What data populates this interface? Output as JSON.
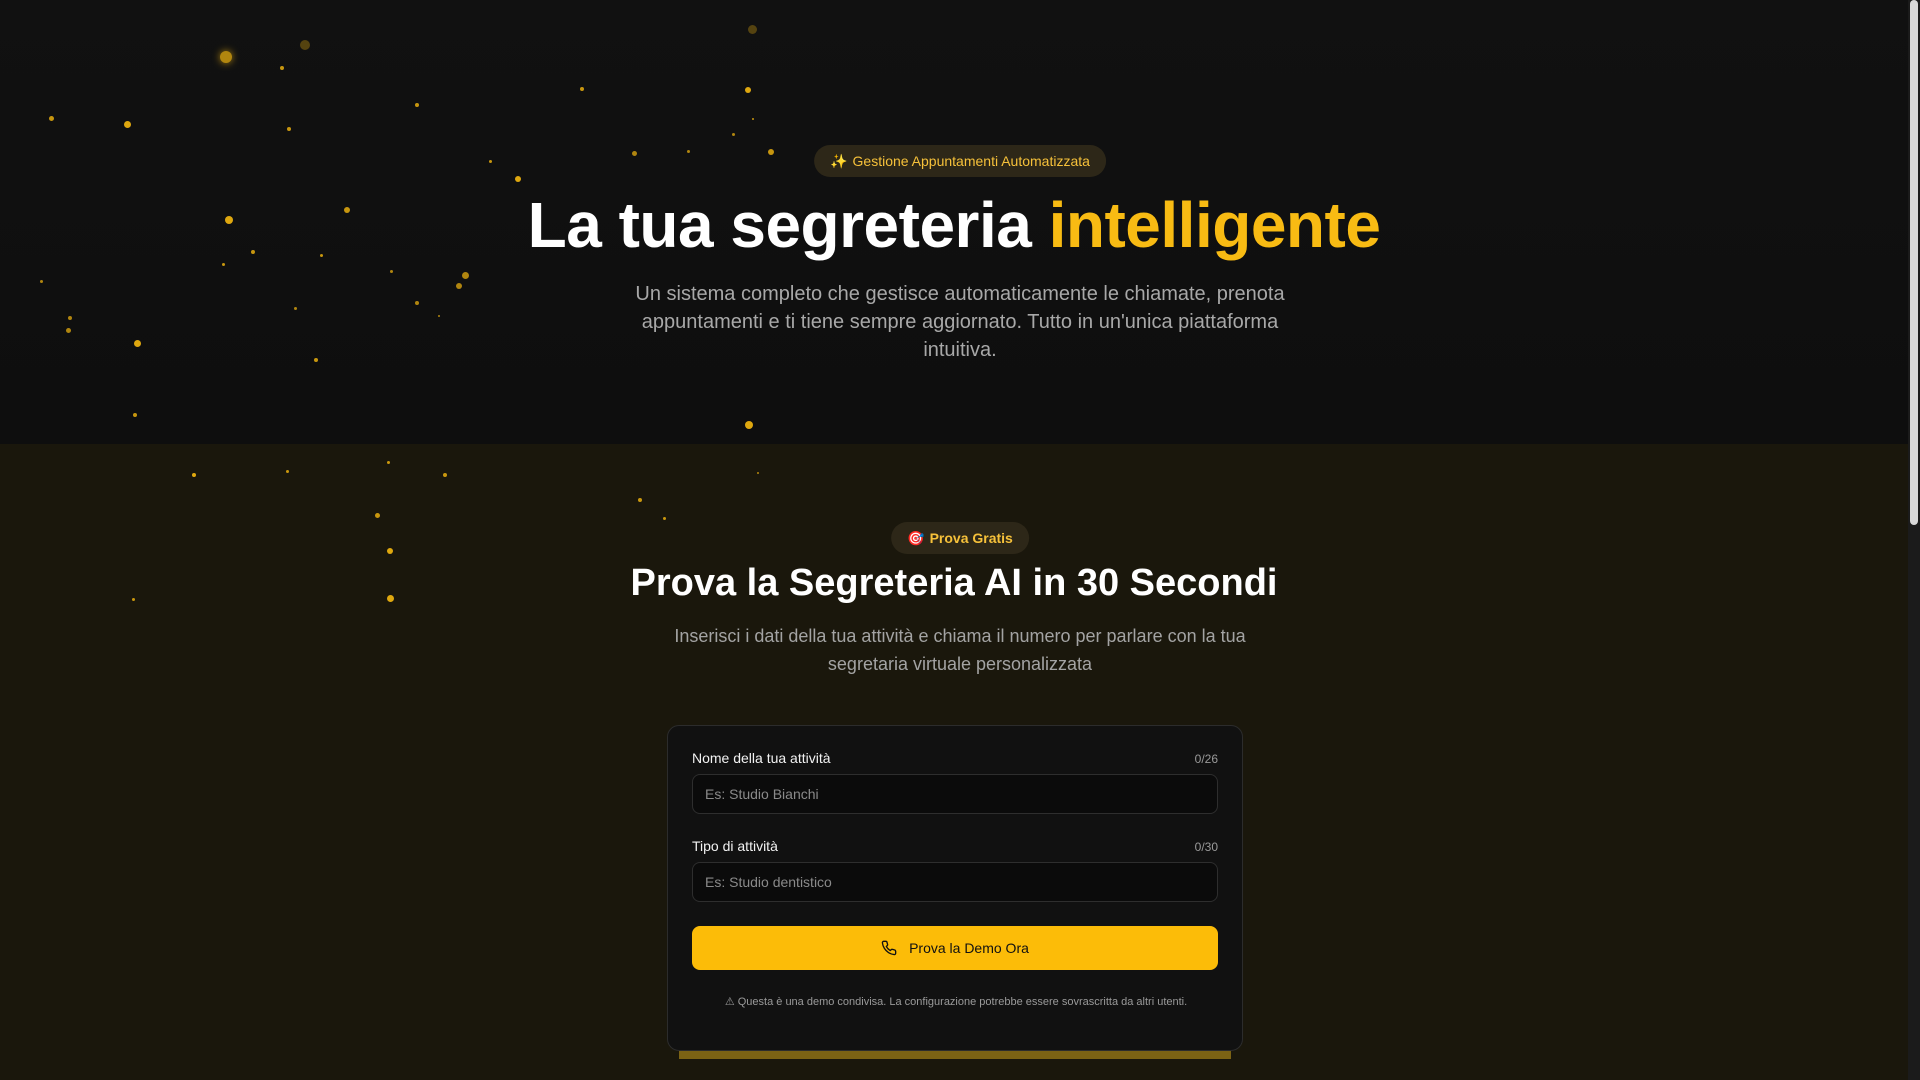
{
  "hero": {
    "badge_emoji": "✨",
    "badge_text": "Gestione Appuntamenti Automatizzata",
    "title_main": "La tua segreteria ",
    "title_accent": "intelligente",
    "subtitle": "Un sistema completo che gestisce automaticamente le chiamate, prenota appuntamenti e ti tiene sempre aggiornato. Tutto in un'unica piattaforma intuitiva."
  },
  "demo": {
    "badge_emoji": "🎯",
    "badge_text": "Prova Gratis",
    "title": "Prova la Segreteria AI in 30 Secondi",
    "subtitle": "Inserisci i dati della tua attività e chiama il numero per parlare con la tua segretaria virtuale personalizzata",
    "form": {
      "business_name_label": "Nome della tua attività",
      "business_name_count": "0/26",
      "business_name_placeholder": "Es: Studio Bianchi",
      "business_name_value": "",
      "business_type_label": "Tipo di attività",
      "business_type_count": "0/30",
      "business_type_placeholder": "Es: Studio dentistico",
      "business_type_value": "",
      "submit_label": "Prova la Demo Ora",
      "warning_icon": "warning-icon",
      "warning_text": "⚠ Questa è una demo condivisa. La configurazione potrebbe essere sovrascritta da altri utenti."
    }
  },
  "colors": {
    "accent": "#fcbc08",
    "background_hero": "#111111",
    "background_demo": "#1a170c"
  }
}
